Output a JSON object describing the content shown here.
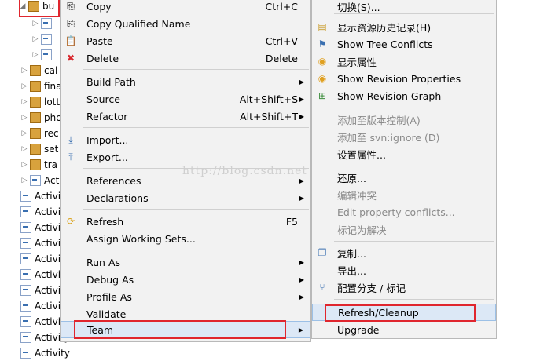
{
  "tree": {
    "root_label": "bu",
    "items": [
      {
        "label": "",
        "type": "java",
        "indent": 2
      },
      {
        "label": "",
        "type": "java",
        "indent": 2
      },
      {
        "label": "",
        "type": "java",
        "indent": 2
      },
      {
        "label": "cal",
        "type": "pkg",
        "indent": 1
      },
      {
        "label": "fina",
        "type": "pkg",
        "indent": 1
      },
      {
        "label": "lott",
        "type": "pkg",
        "indent": 1
      },
      {
        "label": "pho",
        "type": "pkg",
        "indent": 1
      },
      {
        "label": "rec",
        "type": "pkg",
        "indent": 1
      },
      {
        "label": "set",
        "type": "pkg",
        "indent": 1
      },
      {
        "label": "tra",
        "type": "pkg",
        "indent": 1
      },
      {
        "label": "Act",
        "type": "java",
        "indent": 1
      },
      {
        "label": "Activity",
        "type": "java",
        "indent": 0
      },
      {
        "label": "Activity",
        "type": "java",
        "indent": 0
      },
      {
        "label": "Activity",
        "type": "java",
        "indent": 0
      },
      {
        "label": "Activity",
        "type": "java",
        "indent": 0
      },
      {
        "label": "Activity",
        "type": "java",
        "indent": 0
      },
      {
        "label": "Activity",
        "type": "java",
        "indent": 0
      },
      {
        "label": "Activity",
        "type": "java",
        "indent": 0
      },
      {
        "label": "Activity",
        "type": "java",
        "indent": 0
      },
      {
        "label": "Activity",
        "type": "java",
        "indent": 0
      },
      {
        "label": "Activity",
        "type": "java",
        "indent": 0
      },
      {
        "label": "Activity",
        "type": "java",
        "indent": 0
      }
    ]
  },
  "context_menu": {
    "copy": "Copy",
    "copy_sc": "Ctrl+C",
    "copy_qualified": "Copy Qualified Name",
    "paste": "Paste",
    "paste_sc": "Ctrl+V",
    "delete": "Delete",
    "delete_sc": "Delete",
    "build_path": "Build Path",
    "source": "Source",
    "source_sc": "Alt+Shift+S",
    "refactor": "Refactor",
    "refactor_sc": "Alt+Shift+T",
    "import": "Import...",
    "export": "Export...",
    "references": "References",
    "declarations": "Declarations",
    "refresh": "Refresh",
    "refresh_sc": "F5",
    "assign_working_sets": "Assign Working Sets...",
    "run_as": "Run As",
    "debug_as": "Debug As",
    "profile_as": "Profile As",
    "validate": "Validate",
    "team": "Team"
  },
  "team_menu": {
    "switch": "切换(S)...",
    "show_history": "显示资源历史记录(H)",
    "show_tree_conflicts": "Show Tree Conflicts",
    "show_properties": "显示属性",
    "show_revision_properties": "Show Revision Properties",
    "show_revision_graph": "Show Revision Graph",
    "add_version_control": "添加至版本控制(A)",
    "add_svn_ignore": "添加至 svn:ignore (D)",
    "set_property": "设置属性...",
    "revert": "还原...",
    "edit_conflicts": "编辑冲突",
    "edit_property_conflicts": "Edit property conflicts...",
    "mark_resolved": "标记为解决",
    "copy": "复制...",
    "export": "导出...",
    "branch_tag": "配置分支 / 标记",
    "refresh_cleanup": "Refresh/Cleanup",
    "upgrade": "Upgrade"
  },
  "watermark": "http://blog.csdn.net",
  "colors": {
    "highlight_border": "#e0262e",
    "menu_bg": "#f2f2f2",
    "hover_bg": "#dce8f6"
  }
}
